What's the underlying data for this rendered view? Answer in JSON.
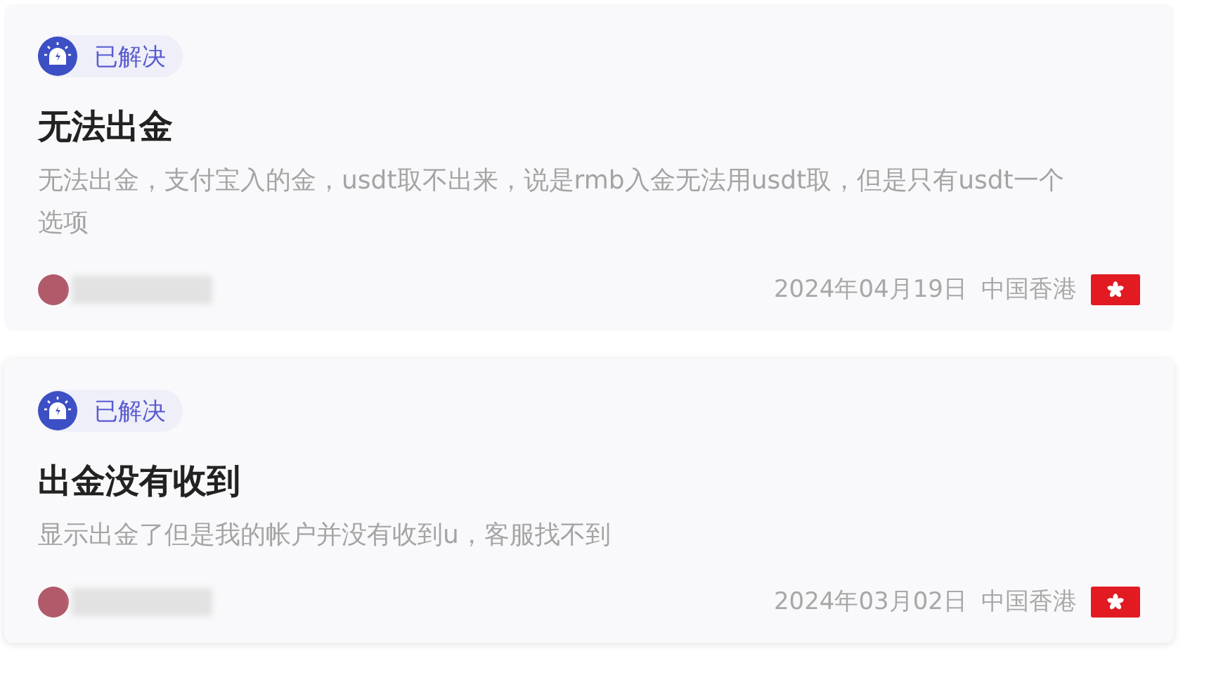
{
  "posts": [
    {
      "status": "已解决",
      "resolved": true,
      "title": "无法出金",
      "description": "无法出金，支付宝入的金，usdt取不出来，说是rmb入金无法用usdt取，但是只有usdt一个选项",
      "date": "2024年04月19日",
      "region": "中国香港"
    },
    {
      "status": "已解决",
      "resolved": true,
      "title": "出金没有收到",
      "description": "显示出金了但是我的帐户并没有收到u，客服找不到",
      "date": "2024年03月02日",
      "region": "中国香港"
    }
  ]
}
